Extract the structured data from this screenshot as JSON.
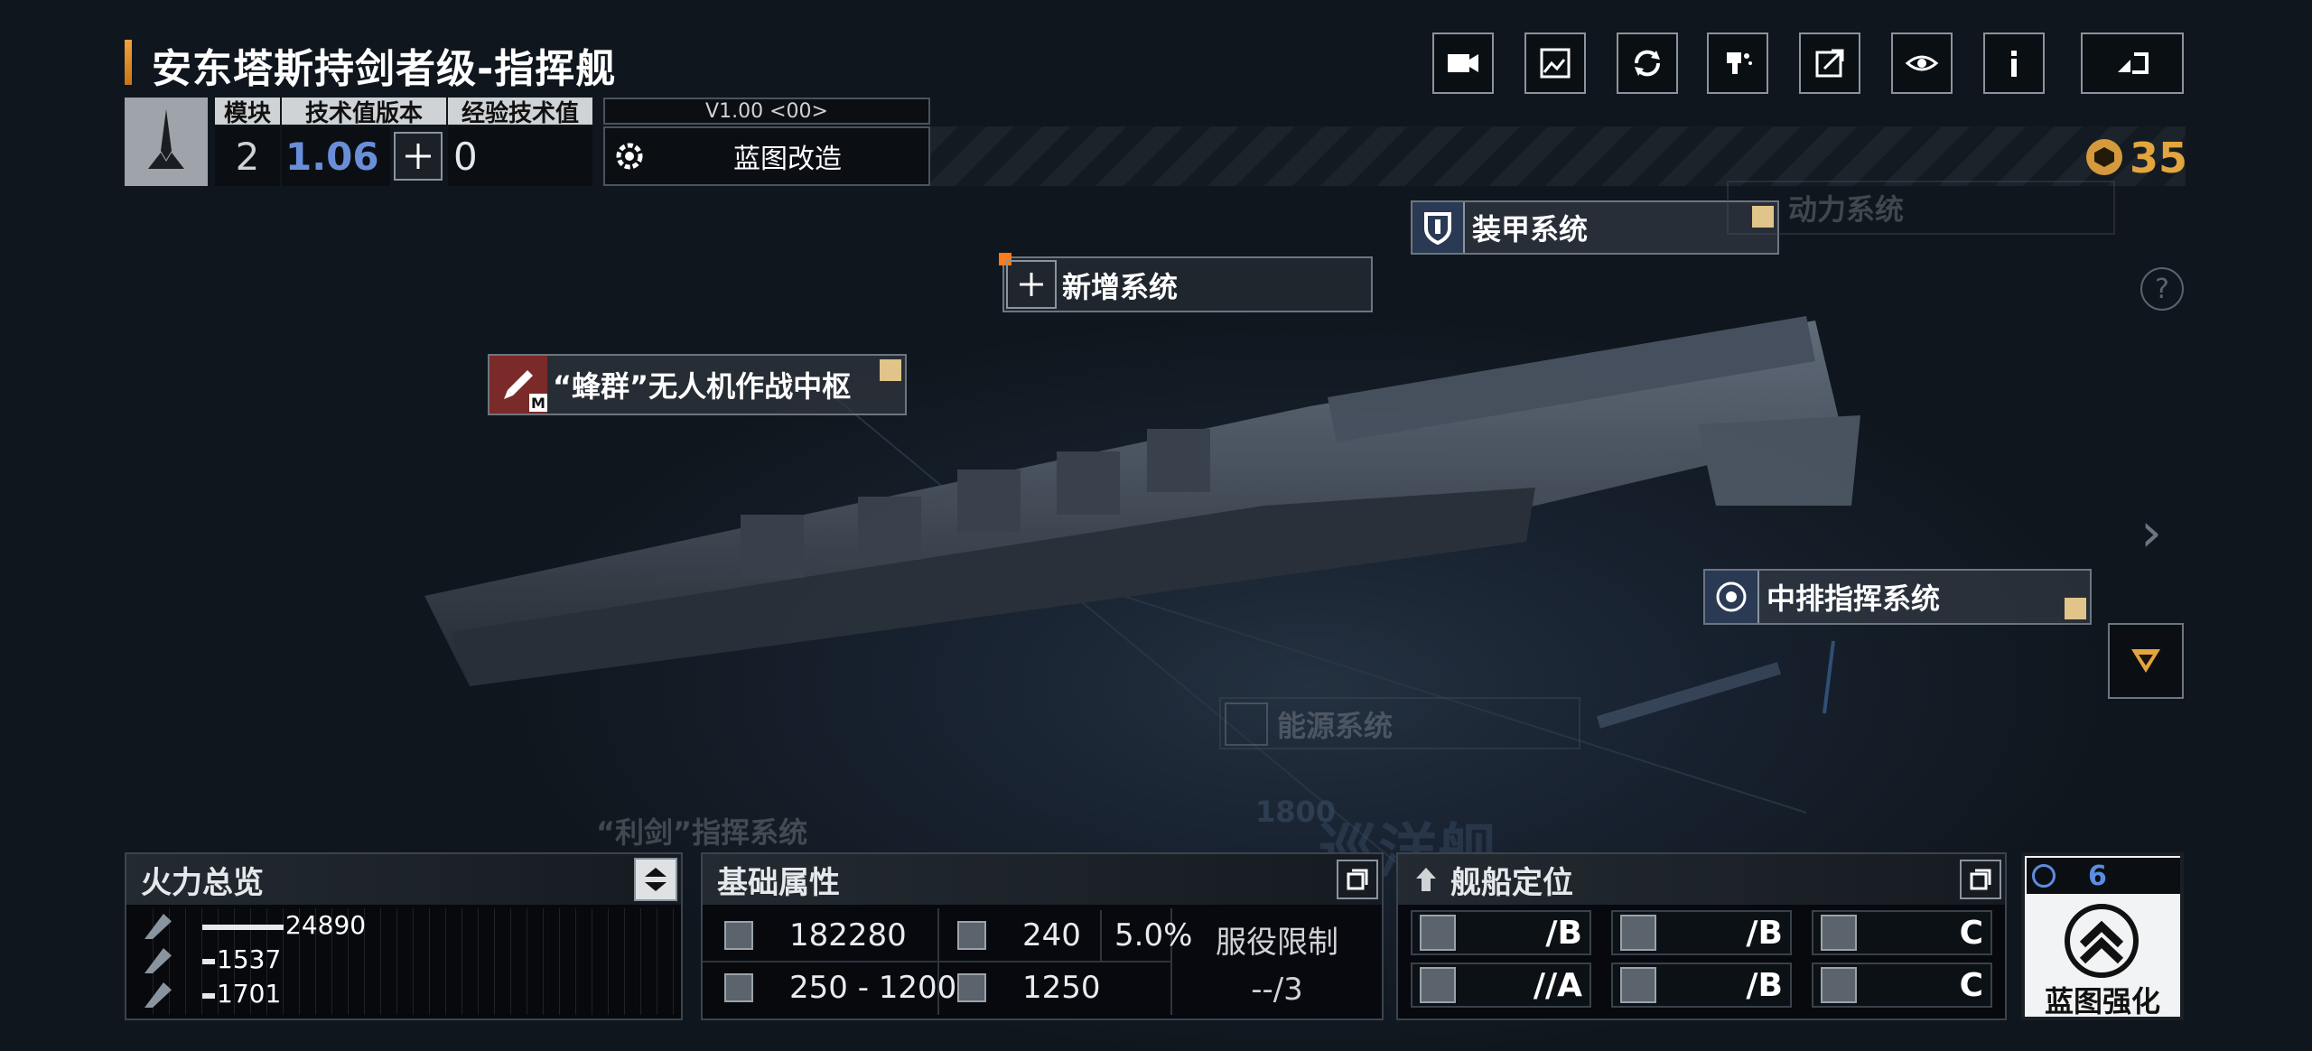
{
  "header": {
    "title": "安东塔斯持剑者级-指挥舰",
    "cols": {
      "module": "模块",
      "tech_version": "技术值版本",
      "exp_tech": "经验技术值"
    },
    "module_value": "2",
    "tech_version_value": "1.06",
    "exp_tech_value": "0",
    "version_label": "V1.00 <00>",
    "blueprint_mod_label": "蓝图改造",
    "currency_value": "35"
  },
  "toolbar": {
    "icons": [
      "camera-icon",
      "gallery-icon",
      "refresh-icon",
      "paint-icon",
      "share-icon",
      "view-icon",
      "info-icon",
      "back-icon"
    ]
  },
  "systems": {
    "armor": "装甲系统",
    "power": "动力系统",
    "new_system": "新增系统",
    "swarm": "“蜂群”无人机作战中枢",
    "swarm_badge": "M",
    "command": "中排指挥系统",
    "energy": "能源系统",
    "sword_command": "“利剑”指挥系统"
  },
  "firepower": {
    "title": "火力总览",
    "rows": [
      {
        "value": "24890",
        "fill": 1.0
      },
      {
        "value": "1537",
        "fill": 0.06
      },
      {
        "value": "1701",
        "fill": 0.07
      }
    ]
  },
  "base_stats": {
    "title": "基础属性",
    "hp": "182280",
    "armor": "240",
    "armor_pct": "5.0%",
    "range": "250 - 1200",
    "speed": "1250",
    "service_label": "服役限制",
    "service_value": "--/3"
  },
  "positioning": {
    "title": "舰船定位",
    "grades": [
      "/B",
      "/B",
      "C",
      "//A",
      "/B",
      "C"
    ]
  },
  "blueprint_strengthen": {
    "count": "6",
    "label": "蓝图强化"
  },
  "watermark": {
    "line1": "1800",
    "line2": "巡洋舰"
  }
}
